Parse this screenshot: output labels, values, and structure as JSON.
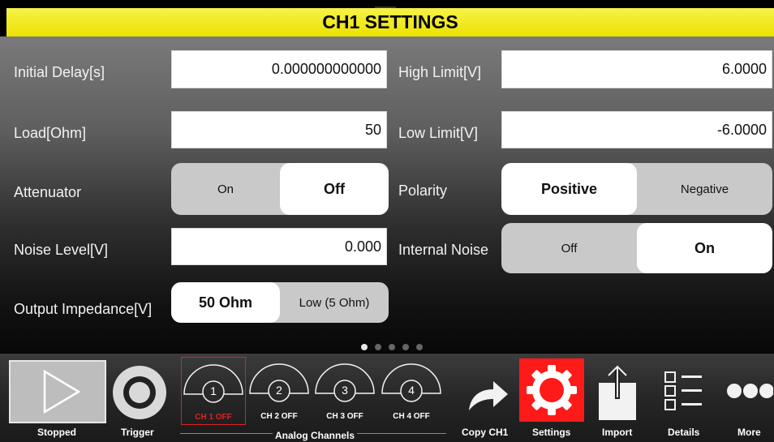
{
  "title": "CH1 SETTINGS",
  "fields": {
    "initial_delay": {
      "label": "Initial Delay[s]",
      "value": "0.000000000000"
    },
    "load": {
      "label": "Load[Ohm]",
      "value": "50"
    },
    "noise_level": {
      "label": "Noise Level[V]",
      "value": "0.000"
    },
    "high_limit": {
      "label": "High Limit[V]",
      "value": "6.0000"
    },
    "low_limit": {
      "label": "Low Limit[V]",
      "value": "-6.0000"
    }
  },
  "toggles": {
    "attenuator": {
      "label": "Attenuator",
      "options": [
        "On",
        "Off"
      ],
      "selected": "Off"
    },
    "output_impedance": {
      "label": "Output Impedance[V]",
      "options": [
        "50 Ohm",
        "Low (5 Ohm)"
      ],
      "selected": "50 Ohm"
    },
    "polarity": {
      "label": "Polarity",
      "options": [
        "Positive",
        "Negative"
      ],
      "selected": "Positive"
    },
    "internal_noise": {
      "label": "Internal Noise",
      "options": [
        "Off",
        "On"
      ],
      "selected": "On"
    }
  },
  "pager": {
    "count": 5,
    "active": 0
  },
  "toolbar": {
    "stopped": "Stopped",
    "trigger": "Trigger",
    "channels_group": "Analog Channels",
    "channels": [
      {
        "num": "1",
        "status": "CH 1 OFF"
      },
      {
        "num": "2",
        "status": "CH 2 OFF"
      },
      {
        "num": "3",
        "status": "CH 3 OFF"
      },
      {
        "num": "4",
        "status": "CH 4 OFF"
      }
    ],
    "copy": "Copy CH1",
    "settings": "Settings",
    "import": "Import",
    "details": "Details",
    "more": "More"
  },
  "colors": {
    "title_bar": "#f0e600",
    "settings_active": "#ff1a1a",
    "channel_selected": "#e02020"
  }
}
